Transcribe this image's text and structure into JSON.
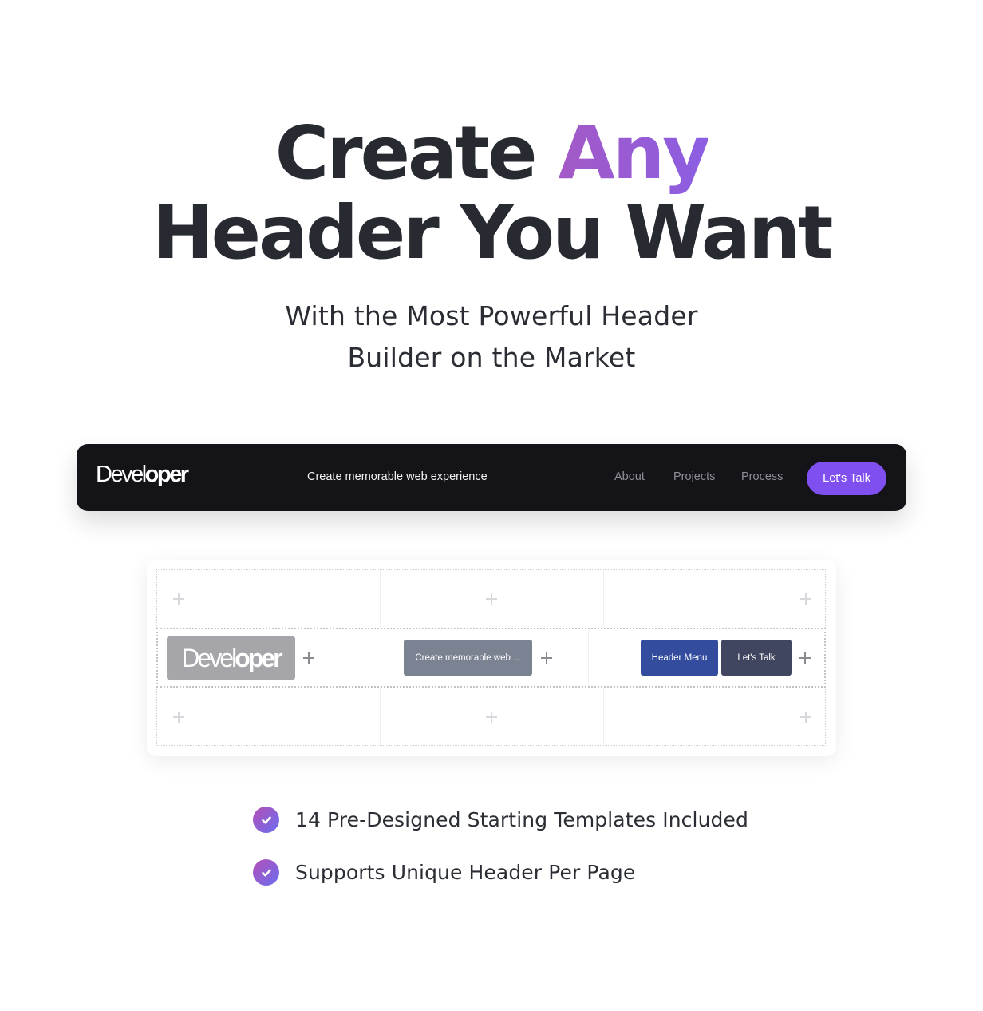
{
  "hero": {
    "line1_plain": "Create ",
    "line1_accent": "Any",
    "line2": "Header You Want",
    "subtitle_line1": "With the Most Powerful Header",
    "subtitle_line2": "Builder on the Market",
    "accent_gradient": [
      "#a459c6",
      "#8b5ee3"
    ]
  },
  "preview_header": {
    "logo_light": "Devel",
    "logo_bold": "oper",
    "tagline": "Create memorable web experience",
    "nav": [
      "About",
      "Projects",
      "Process"
    ],
    "cta_label": "Let's Talk",
    "background": "#141418",
    "cta_color": "#7f4ff0"
  },
  "builder": {
    "logo_chip_light": "Devel",
    "logo_chip_bold": "oper",
    "tagline_chip": "Create memorable web ...",
    "menu_chip": "Header Menu",
    "cta_chip": "Let's Talk",
    "add_icon": "plus-icon",
    "colors": {
      "logo_chip": "#a6a6aa",
      "tagline_chip": "#7b8291",
      "menu_chip": "#334c9e",
      "cta_chip": "#404660"
    }
  },
  "features": [
    {
      "icon": "check-circle-icon",
      "text": "14 Pre-Designed Starting Templates Included"
    },
    {
      "icon": "check-circle-icon",
      "text": "Supports Unique Header Per Page"
    }
  ]
}
